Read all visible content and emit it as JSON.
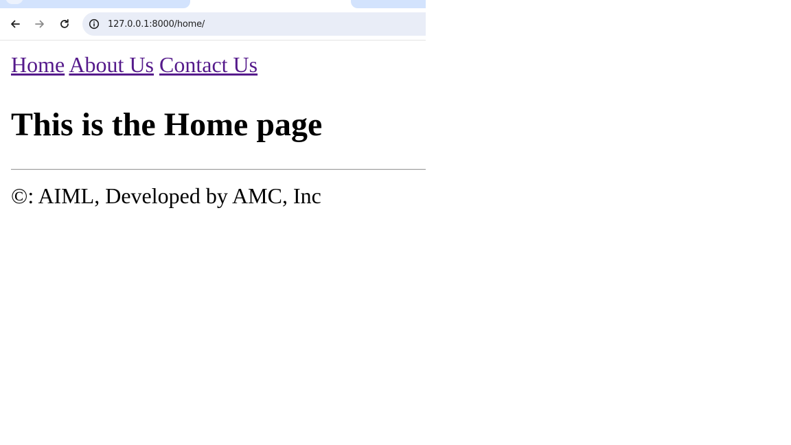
{
  "browser": {
    "address_bar": {
      "url": "127.0.0.1:8000/home/"
    },
    "icons": {
      "back": "arrow-left-icon",
      "forward": "arrow-right-icon",
      "reload": "reload-icon",
      "site_info": "info-circle-icon"
    },
    "colors": {
      "tab_active": "#d3e3fd",
      "omnibox_bg": "#e9edf7"
    }
  },
  "page": {
    "nav": {
      "home": "Home",
      "about": "About Us",
      "contact": "Contact Us"
    },
    "heading": "This is the Home page",
    "footer": "©: AIML, Developed by AMC, Inc",
    "colors": {
      "visited_link": "#551a8b",
      "text": "#000000"
    }
  }
}
